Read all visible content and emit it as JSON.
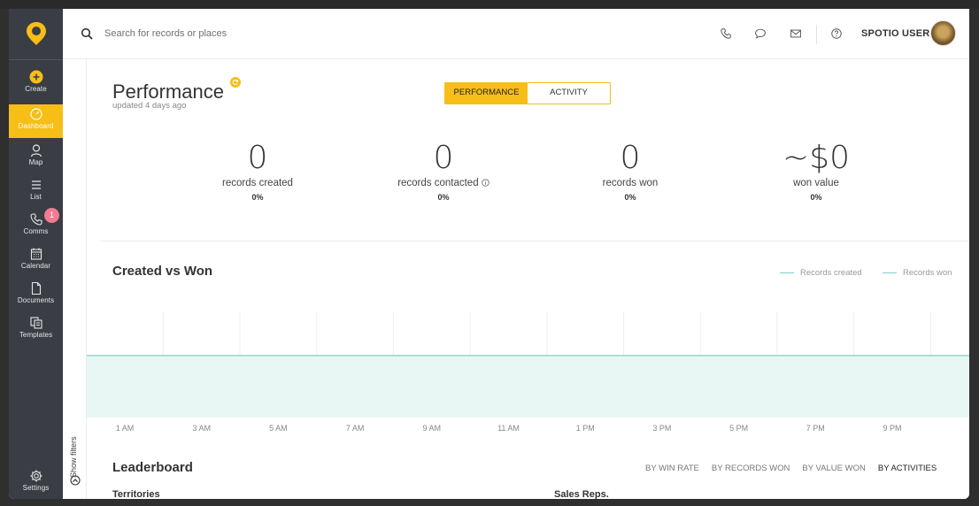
{
  "sidebar": {
    "create_label": "Create",
    "items": [
      {
        "id": "dashboard",
        "label": "Dashboard",
        "active": true
      },
      {
        "id": "map",
        "label": "Map"
      },
      {
        "id": "list",
        "label": "List"
      },
      {
        "id": "comms",
        "label": "Comms",
        "badge": "1"
      },
      {
        "id": "calendar",
        "label": "Calendar"
      },
      {
        "id": "documents",
        "label": "Documents"
      },
      {
        "id": "templates",
        "label": "Templates"
      }
    ],
    "settings_label": "Settings"
  },
  "header": {
    "search_placeholder": "Search for records or places",
    "user_name": "SPOTIO USER",
    "icons": [
      "search-icon",
      "phone-icon",
      "chat-icon",
      "mail-icon",
      "help-icon"
    ]
  },
  "filters": {
    "show_label": "Show filters"
  },
  "page": {
    "title": "Performance",
    "updated": "updated 4 days ago",
    "tabs": [
      {
        "label": "PERFORMANCE",
        "active": true
      },
      {
        "label": "ACTIVITY",
        "active": false
      }
    ]
  },
  "stats": [
    {
      "value": "0",
      "label": "records created",
      "pct": "0%"
    },
    {
      "value": "0",
      "label": "records contacted",
      "pct": "0%",
      "info": true
    },
    {
      "value": "0",
      "label": "records won",
      "pct": "0%"
    },
    {
      "value": "~$0",
      "label": "won value",
      "pct": "0%"
    }
  ],
  "chart_section": {
    "title": "Created vs Won",
    "legend": [
      "Records created",
      "Records won"
    ]
  },
  "chart_data": {
    "type": "area",
    "title": "Created vs Won",
    "categories": [
      "1 AM",
      "3 AM",
      "5 AM",
      "7 AM",
      "9 AM",
      "11 AM",
      "1 PM",
      "3 PM",
      "5 PM",
      "7 PM",
      "9 PM"
    ],
    "series": [
      {
        "name": "Records created",
        "values": [
          0,
          0,
          0,
          0,
          0,
          0,
          0,
          0,
          0,
          0,
          0
        ]
      },
      {
        "name": "Records won",
        "values": [
          0,
          0,
          0,
          0,
          0,
          0,
          0,
          0,
          0,
          0,
          0
        ]
      }
    ],
    "colors": {
      "line": "#9fd9d1",
      "fill": "#e6f6f3"
    },
    "grid": true,
    "legend_position": "top-right"
  },
  "leaderboard": {
    "title": "Leaderboard",
    "tabs": [
      {
        "label": "BY WIN RATE"
      },
      {
        "label": "BY RECORDS WON"
      },
      {
        "label": "BY VALUE WON"
      },
      {
        "label": "BY ACTIVITIES",
        "active": true
      }
    ],
    "territories_label": "Territories",
    "sales_reps_label": "Sales Reps."
  },
  "colors": {
    "accent": "#f6be17",
    "sidebar": "#3a3d44",
    "badge": "#f07b92",
    "teal": "#7ccfc6"
  }
}
